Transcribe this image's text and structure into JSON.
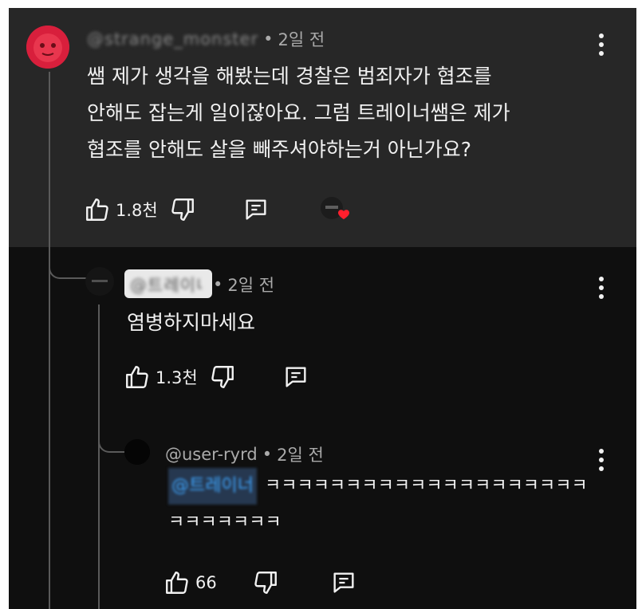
{
  "comment": {
    "author": "@strange_monster",
    "time": "2일 전",
    "lines": [
      "쌤 제가 생각을 해봤는데 경찰은 범죄자가 협조를",
      "안해도 잡는게 일이잖아요. 그럼 트레이너쌤은 제가",
      "협조를 안해도 살을 빼주셔야하는거 아닌가요?"
    ],
    "likes": "1.8천"
  },
  "reply1": {
    "author": "@트레이너",
    "time": "2일 전",
    "text": "염병하지마세요",
    "likes": "1.3천"
  },
  "reply2": {
    "author": "@user-ryrd",
    "time": "2일 전",
    "mention": "@트레이너",
    "line1": "ㅋㅋㅋㅋㅋㅋㅋㅋㅋㅋㅋㅋㅋㅋㅋㅋㅋㅋㅋㅋ",
    "line2": "ㅋㅋㅋㅋㅋㅋㅋ",
    "likes": "66"
  },
  "icons": {
    "like": "thumbs-up-icon",
    "dislike": "thumbs-down-icon",
    "reply": "comment-reply-icon",
    "more": "more-vertical-icon"
  },
  "colors": {
    "background": "#0f0f0f",
    "highlight": "#272727",
    "text": "#f1f1f1",
    "meta": "#aaaaaa",
    "mention": "#3ea6ff",
    "heart": "#ff1f2d"
  }
}
